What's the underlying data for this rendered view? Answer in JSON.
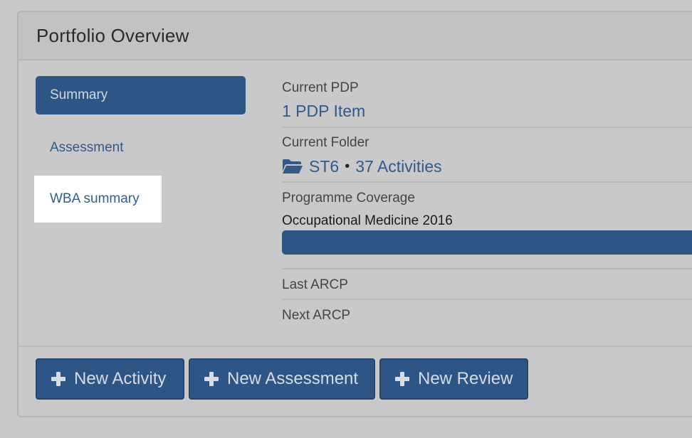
{
  "panel": {
    "title": "Portfolio Overview"
  },
  "nav": {
    "items": [
      {
        "label": "Summary",
        "active": true
      },
      {
        "label": "Assessment",
        "active": false
      },
      {
        "label": "WBA summary",
        "active": false,
        "highlighted": true
      }
    ]
  },
  "summary": {
    "current_pdp_label": "Current PDP",
    "current_pdp_value": "1 PDP Item",
    "current_folder_label": "Current Folder",
    "folder_icon": "folder-open-icon",
    "folder_name": "ST6",
    "folder_separator": "•",
    "folder_activities": "37 Activities",
    "programme_coverage_label": "Programme Coverage",
    "programme_name": "Occupational Medicine 2016",
    "programme_progress_fraction": 1.0,
    "last_arcp_label": "Last ARCP",
    "next_arcp_label": "Next ARCP"
  },
  "actions": {
    "new_activity": "New Activity",
    "new_assessment": "New Assessment",
    "new_review": "New Review",
    "icon": "plus-icon"
  },
  "colors": {
    "accent": "#2d5585",
    "link": "#2f5a8a",
    "background": "#c9c9c9"
  }
}
